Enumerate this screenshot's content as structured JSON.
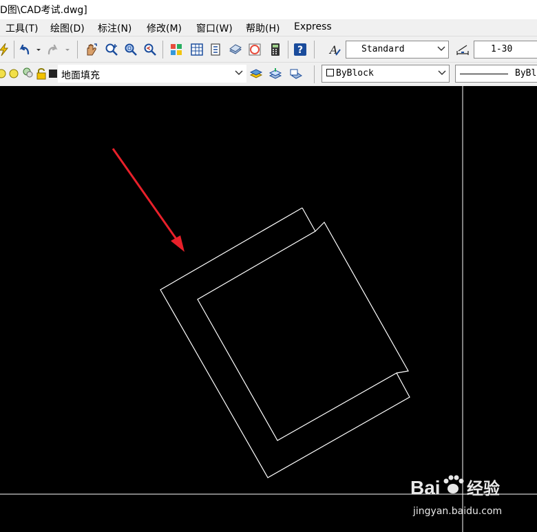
{
  "window": {
    "title": "D图\\CAD考试.dwg]"
  },
  "menu": [
    {
      "label": "工具(T)"
    },
    {
      "label": "绘图(D)"
    },
    {
      "label": "标注(N)"
    },
    {
      "label": "修改(M)"
    },
    {
      "label": "窗口(W)"
    },
    {
      "label": "帮助(H)"
    },
    {
      "label": "Express"
    }
  ],
  "toolbar": {
    "text_style": "Standard",
    "dim_scale": "1-30"
  },
  "layers": {
    "current_layer": "地面填充",
    "color": "ByBlock",
    "linetype": "ByBl"
  },
  "watermark": {
    "logo_text_a": "Bai",
    "logo_text_b": "经验",
    "url": "jingyan.baidu.com"
  },
  "colors": {
    "canvas_bg": "#000000",
    "lines": "#ffffff",
    "arrow": "#e8202a",
    "toolbar_bg": "#f0f0f0"
  }
}
